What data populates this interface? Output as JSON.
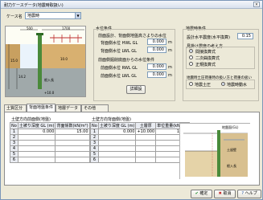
{
  "window": {
    "title": "耐力ケースデータ(地震時取扱い)",
    "close": "×"
  },
  "case_label": "ケース名",
  "case_select": "地震時",
  "diagram": {
    "top_values": [
      "500",
      "1700"
    ],
    "left_values": [
      "15.0",
      "14.2"
    ],
    "mid_values": [
      "10.0"
    ],
    "sheet_label": "根入長",
    "depth_label": "+10.0"
  },
  "water": {
    "heading": "水位条件",
    "sub1": "前面設計、背面側地盤高さよりの水位",
    "hwl_label": "背面側水位 HWL   GL",
    "hwl_value": "0.000",
    "hwl_unit": "m",
    "lwl_label": "背面側水位 LWL   GL",
    "lwl_value": "0.000",
    "lwl_unit": "m",
    "sub2": "前面側掘削底面からの水位条件",
    "fhwl_label": "前面側水位 RWL   GL",
    "fhwl_value": "0.000",
    "fhwl_unit": "m",
    "flwl_label": "前面側水位 LWL   GL",
    "flwl_value": "0.000",
    "flwl_unit": "m",
    "button": "詳細設"
  },
  "seismic": {
    "heading": "地震時条件",
    "coef_label": "設計水平震度(水平換算)",
    "coef_value": "0.15",
    "method_heading": "見掛け震度の考え方",
    "methods": [
      "間接換算式",
      "二次曲換算式",
      "正規換算式"
    ],
    "method_selected": 0,
    "check_heading": "地震時土圧荷重時の扱い方と荷重の扱い",
    "checks": [
      "地震土圧",
      "地震時動水"
    ],
    "check_selected": 1
  },
  "tabs": [
    "土質区分",
    "背面地盤条件",
    "地層データ",
    "その他"
  ],
  "active_tab": 1,
  "left_table": {
    "heading": "土壁方向前面側(地盤)",
    "columns": [
      "No",
      "土被り深度 GL (m)",
      "背面係数(kN/m²)"
    ],
    "rows": [
      [
        "1",
        "0.000",
        "15.00"
      ],
      [
        "2",
        "",
        ""
      ],
      [
        "3",
        "",
        ""
      ],
      [
        "4",
        "",
        ""
      ],
      [
        "5",
        "",
        ""
      ],
      [
        "6",
        "",
        ""
      ]
    ]
  },
  "right_table": {
    "heading": "土壁方向背面側(地盤)",
    "columns": [
      "No",
      "土被り深度 GL (m)",
      "土層厚",
      "単位重量(kN/m³)"
    ],
    "subcolumns": [
      "",
      "上端",
      "下端",
      ""
    ],
    "rows": [
      [
        "1",
        "0.000",
        "+10.000",
        "15.00"
      ],
      [
        "2",
        "",
        "",
        ""
      ],
      [
        "3",
        "",
        "",
        ""
      ],
      [
        "4",
        "",
        "",
        ""
      ],
      [
        "5",
        "",
        "",
        ""
      ],
      [
        "6",
        "",
        "",
        ""
      ]
    ]
  },
  "section": {
    "top_label": "地盤面(GL)",
    "label_a": "土留壁",
    "label_b": "根入長"
  },
  "footer": {
    "ok": "確定",
    "cancel": "取消",
    "help": "ヘルプ"
  },
  "colors": {
    "accent": "#1a4ea0",
    "soil": "#c8a060",
    "wall": "#4a8a3a",
    "water": "#3a78d8"
  }
}
